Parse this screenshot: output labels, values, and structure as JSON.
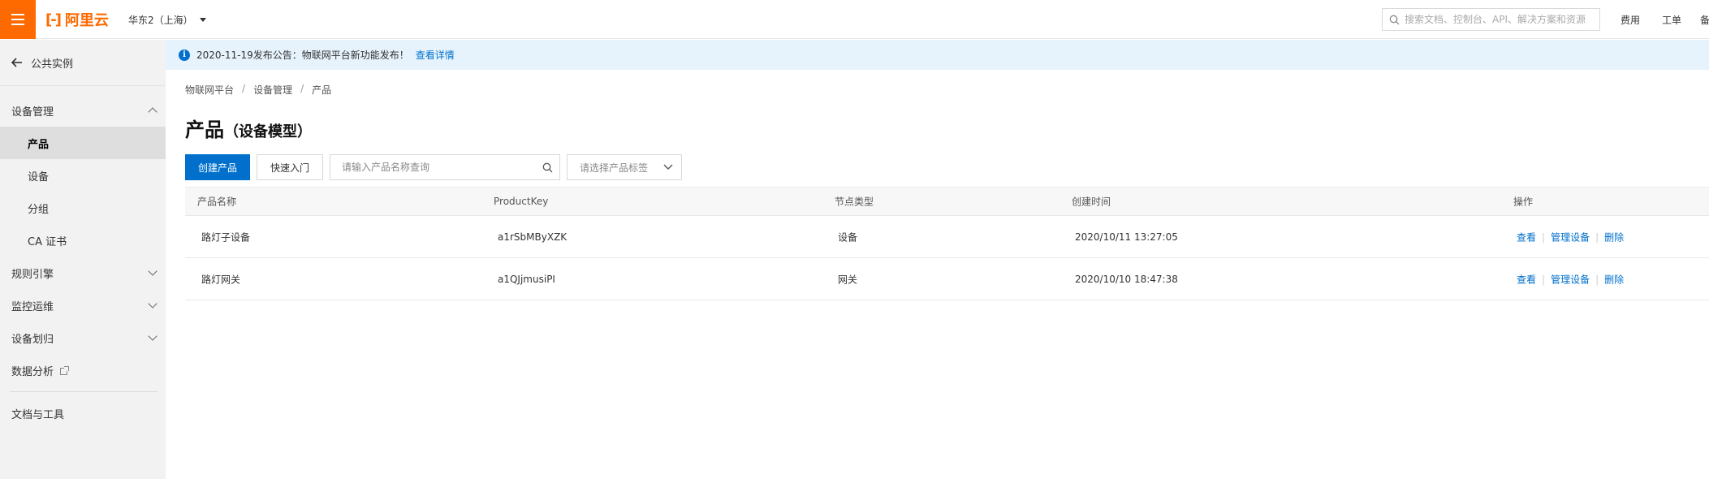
{
  "topbar": {
    "logo_mark": "[-]",
    "logo_text": "阿里云",
    "region": "华东2（上海）",
    "search_placeholder": "搜索文档、控制台、API、解决方案和资源",
    "links": [
      "费用",
      "工单",
      "备"
    ]
  },
  "sidebar": {
    "back_label": "公共实例",
    "group_device": "设备管理",
    "sub_items": [
      "产品",
      "设备",
      "分组",
      "CA 证书"
    ],
    "active_item": "产品",
    "group_rules": "规则引擎",
    "group_monitor": "监控运维",
    "group_assign": "设备划归",
    "data_analysis": "数据分析",
    "docs_tools": "文档与工具"
  },
  "notice": {
    "text": "2020-11-19发布公告：物联网平台新功能发布！",
    "link": "查看详情"
  },
  "breadcrumb": [
    "物联网平台",
    "设备管理",
    "产品"
  ],
  "page": {
    "title": "产品",
    "title_suffix": "（设备模型）"
  },
  "toolbar": {
    "create_label": "创建产品",
    "quick_label": "快速入门",
    "query_placeholder": "请输入产品名称查询",
    "tag_placeholder": "请选择产品标签"
  },
  "table": {
    "headers": [
      "产品名称",
      "ProductKey",
      "节点类型",
      "创建时间",
      "操作"
    ],
    "rows": [
      {
        "name": "路灯子设备",
        "key": "a1rSbMByXZK",
        "node_type": "设备",
        "created": "2020/10/11 13:27:05"
      },
      {
        "name": "路灯网关",
        "key": "a1QJjmusiPI",
        "node_type": "网关",
        "created": "2020/10/10 18:47:38"
      }
    ],
    "actions": [
      "查看",
      "管理设备",
      "删除"
    ]
  },
  "colors": {
    "brand": "#ff6a00",
    "primary": "#0070cc",
    "notice_bg": "#e6f3fc"
  }
}
